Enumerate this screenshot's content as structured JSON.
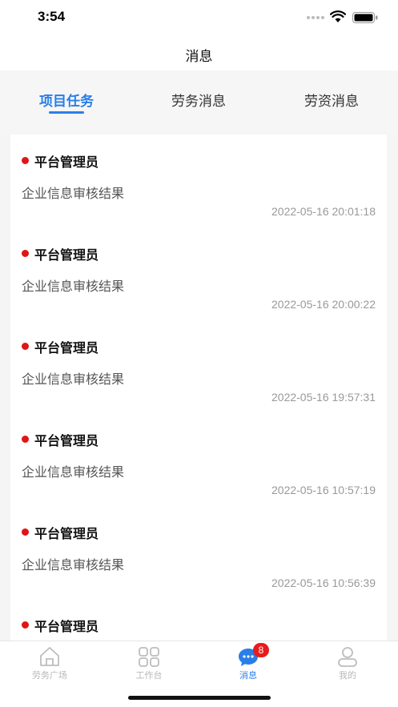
{
  "status_bar": {
    "time": "3:54",
    "icons": [
      "cellular-icon",
      "wifi-icon",
      "battery-icon"
    ]
  },
  "header": {
    "title": "消息"
  },
  "tabs": [
    {
      "label": "项目任务",
      "active": true
    },
    {
      "label": "劳务消息",
      "active": false
    },
    {
      "label": "劳资消息",
      "active": false
    }
  ],
  "messages": [
    {
      "sender": "平台管理员",
      "subject": "企业信息审核结果",
      "time": "2022-05-16 20:01:18",
      "unread": true
    },
    {
      "sender": "平台管理员",
      "subject": "企业信息审核结果",
      "time": "2022-05-16 20:00:22",
      "unread": true
    },
    {
      "sender": "平台管理员",
      "subject": "企业信息审核结果",
      "time": "2022-05-16 19:57:31",
      "unread": true
    },
    {
      "sender": "平台管理员",
      "subject": "企业信息审核结果",
      "time": "2022-05-16 10:57:19",
      "unread": true
    },
    {
      "sender": "平台管理员",
      "subject": "企业信息审核结果",
      "time": "2022-05-16 10:56:39",
      "unread": true
    },
    {
      "sender": "平台管理员",
      "subject": "",
      "time": "",
      "unread": true
    }
  ],
  "bottom_nav": [
    {
      "label": "劳务广场",
      "icon": "home-icon",
      "active": false
    },
    {
      "label": "工作台",
      "icon": "grid-icon",
      "active": false
    },
    {
      "label": "消息",
      "icon": "message-icon",
      "active": true,
      "badge": "8"
    },
    {
      "label": "我的",
      "icon": "user-icon",
      "active": false
    }
  ],
  "colors": {
    "accent": "#2a7ee8",
    "unread_dot": "#e01515",
    "badge": "#e81c1c"
  }
}
